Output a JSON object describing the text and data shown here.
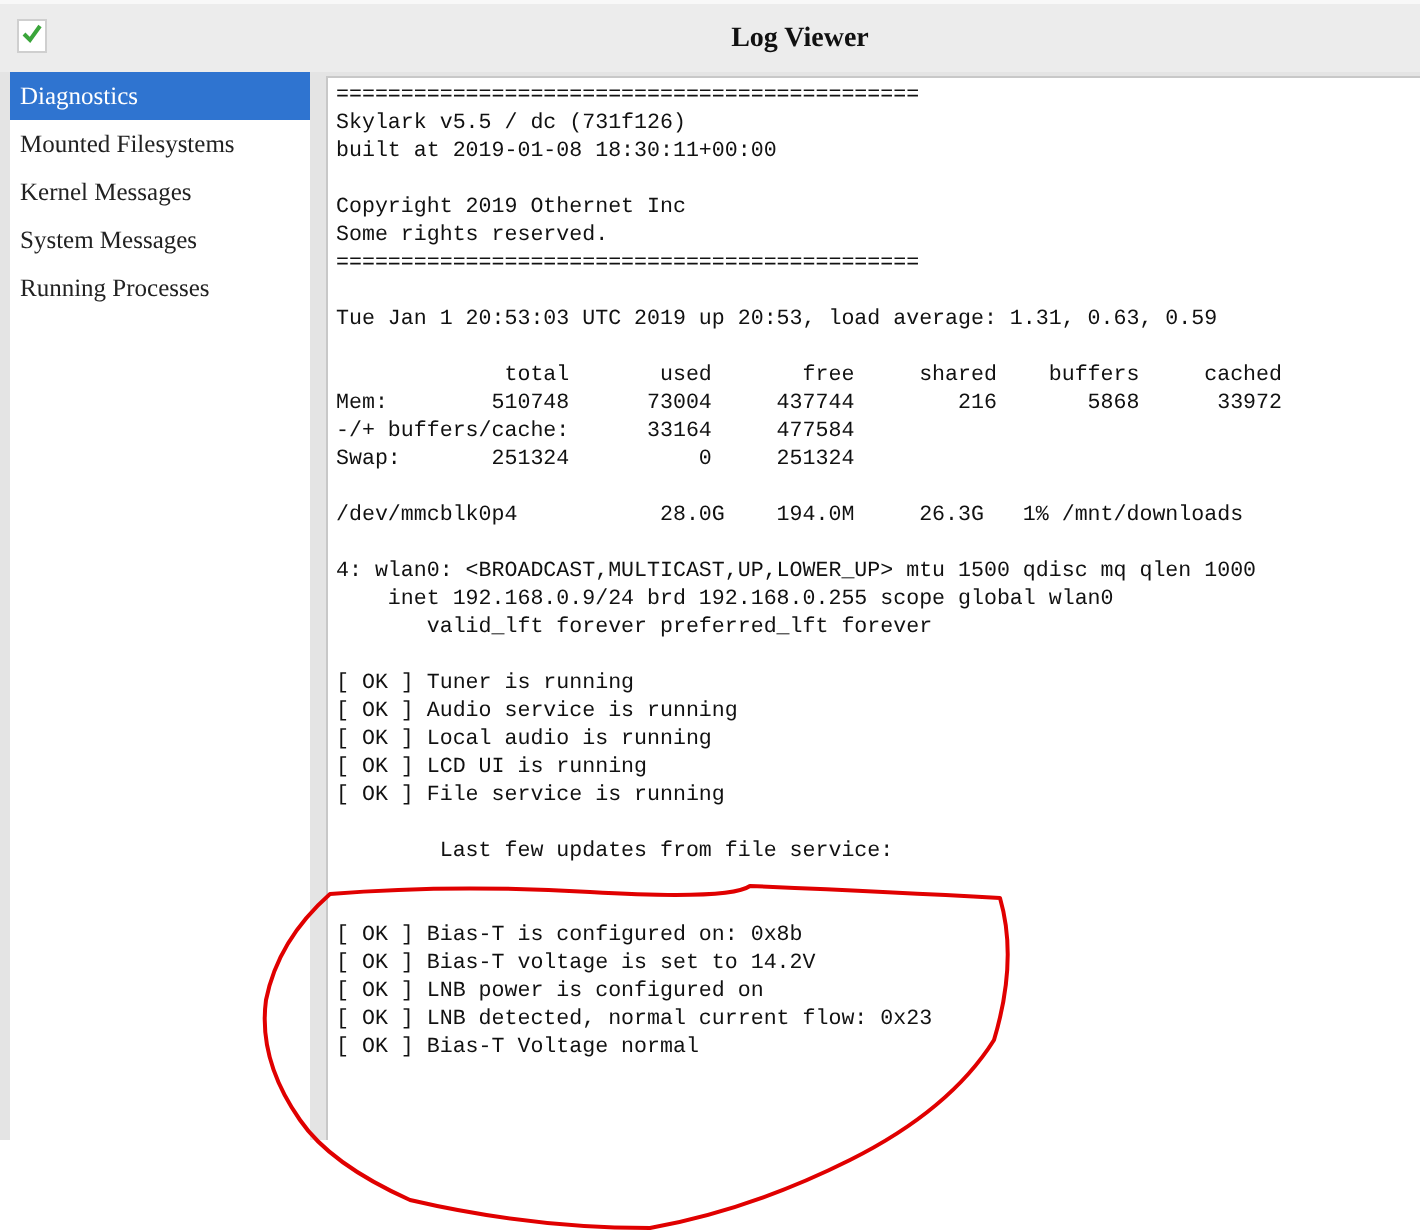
{
  "window": {
    "title": "Log Viewer"
  },
  "sidebar": {
    "items": [
      {
        "label": "Diagnostics",
        "selected": true
      },
      {
        "label": "Mounted Filesystems",
        "selected": false
      },
      {
        "label": "Kernel Messages",
        "selected": false
      },
      {
        "label": "System Messages",
        "selected": false
      },
      {
        "label": "Running Processes",
        "selected": false
      }
    ]
  },
  "log": {
    "blocks": [
      {
        "kind": "plain",
        "lines": [
          "=============================================",
          "Skylark v5.5 / dc (731f126)",
          "built at 2019-01-08 18:30:11+00:00"
        ]
      },
      {
        "kind": "plain",
        "lines": [
          "Copyright 2019 Othernet Inc",
          "Some rights reserved.",
          "============================================="
        ]
      },
      {
        "kind": "plain",
        "lines": [
          "Tue Jan 1 20:53:03 UTC 2019 up 20:53, load average: 1.31, 0.63, 0.59"
        ]
      },
      {
        "kind": "plain",
        "lines": [
          "             total       used       free     shared    buffers     cached",
          "Mem:        510748      73004     437744        216       5868      33972",
          "-/+ buffers/cache:      33164     477584",
          "Swap:       251324          0     251324"
        ]
      },
      {
        "kind": "plain",
        "lines": [
          "/dev/mmcblk0p4           28.0G    194.0M     26.3G   1% /mnt/downloads"
        ]
      },
      {
        "kind": "plain",
        "lines": [
          "4: wlan0: <BROADCAST,MULTICAST,UP,LOWER_UP> mtu 1500 qdisc mq qlen 1000",
          "    inet 192.168.0.9/24 brd 192.168.0.255 scope global wlan0",
          "       valid_lft forever preferred_lft forever"
        ]
      },
      {
        "kind": "plain",
        "lines": [
          "[ OK ] Tuner is running",
          "[ OK ] Audio service is running",
          "[ OK ] Local audio is running",
          "[ OK ] LCD UI is running",
          "[ OK ] File service is running"
        ]
      },
      {
        "kind": "plain",
        "lines": [
          "        Last few updates from file service:"
        ]
      },
      {
        "kind": "circled",
        "lines": [
          "[ OK ] Bias-T is configured on: 0x8b",
          "[ OK ] Bias-T voltage is set to 14.2V",
          "[ OK ] LNB power is configured on",
          "[ OK ] LNB detected, normal current flow: 0x23",
          "[ OK ] Bias-T Voltage normal"
        ]
      }
    ]
  }
}
